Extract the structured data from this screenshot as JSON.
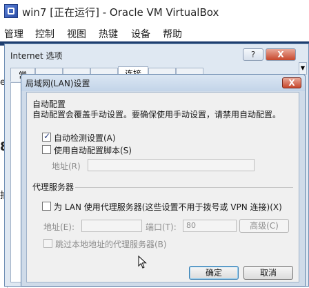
{
  "host": {
    "title": "win7 [正在运行] - Oracle VM VirtualBox",
    "menu": [
      "管理",
      "控制",
      "视图",
      "热键",
      "设备",
      "帮助"
    ]
  },
  "internet_options": {
    "title": "Internet 选项",
    "help_button": "?",
    "close_button": "X",
    "visible_tab_label": "常",
    "selected_tab_label": "连接"
  },
  "guest_edge_chars": [
    "e",
    "8",
    "拍"
  ],
  "lan_dialog": {
    "title": "局域网(LAN)设置",
    "close_button": "X",
    "auto_config": {
      "heading": "自动配置",
      "description": "自动配置会覆盖手动设置。要确保使用手动设置，请禁用自动配置。",
      "detect_label": "自动检测设置(A)",
      "detect_checked": true,
      "script_label": "使用自动配置脚本(S)",
      "script_checked": false,
      "address_label": "地址(R)",
      "address_value": ""
    },
    "proxy": {
      "heading": "代理服务器",
      "use_proxy_label": "为 LAN 使用代理服务器(这些设置不用于拨号或 VPN 连接)(X)",
      "use_proxy_checked": false,
      "address_label": "地址(E):",
      "address_value": "",
      "port_label": "端口(T):",
      "port_value": "80",
      "advanced_button": "高级(C)",
      "bypass_label": "跳过本地地址的代理服务器(B)",
      "bypass_checked": false
    },
    "ok_button": "确定",
    "cancel_button": "取消"
  }
}
